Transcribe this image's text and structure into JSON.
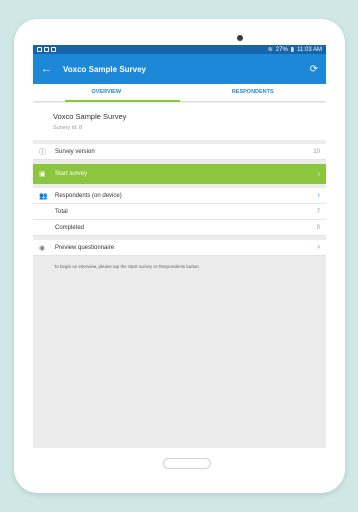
{
  "statusbar": {
    "battery": "27%",
    "time": "11:03 AM"
  },
  "appbar": {
    "back_icon": "←",
    "title": "Voxco Sample Survey",
    "sync_icon": "⟳"
  },
  "tabs": [
    {
      "label": "OVERVIEW"
    },
    {
      "label": "RESPONDENTS"
    }
  ],
  "header": {
    "survey_name": "Voxco Sample Survey",
    "survey_id": "Survey id: 8"
  },
  "survey_version": {
    "label": "Survey version",
    "value": "10"
  },
  "start_survey": {
    "label": "Start survey",
    "chevron": "›"
  },
  "respondents": {
    "label": "Respondents (on device)",
    "chevron": "›"
  },
  "total": {
    "label": "Total",
    "value": "7"
  },
  "completed": {
    "label": "Completed",
    "value": "0"
  },
  "preview": {
    "label": "Preview questionnaire",
    "chevron": "›"
  },
  "hint": "To begin an interview, please tap the Start survey or Respondents button",
  "colors": {
    "primary": "#1e88d8",
    "statusbar": "#1565a8",
    "accent": "#8cc63f"
  }
}
